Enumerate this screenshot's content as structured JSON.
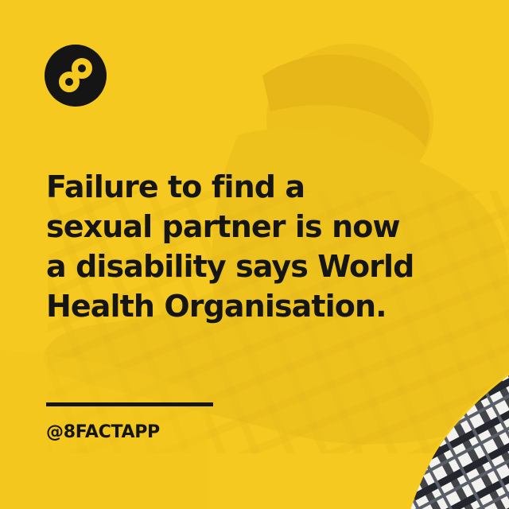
{
  "brand": {
    "logo_icon": "infinity-8-icon",
    "logo_bg": "#151515",
    "logo_fg": "#f5c91f",
    "accent": "#f5c91f",
    "text_color": "#151515"
  },
  "headline": "Failure to find a sexual partner is now a disability says World Health Organisation.",
  "handle": "@8FACTAPP"
}
